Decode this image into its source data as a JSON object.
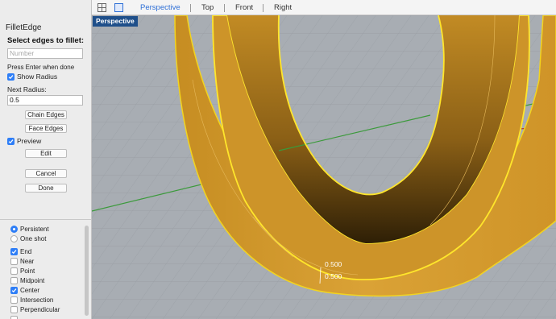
{
  "command": {
    "title": "FilletEdge",
    "prompt": "Select edges to fillet:",
    "number_placeholder": "Number",
    "hint": "Press Enter when done",
    "show_radius_label": "Show Radius",
    "show_radius_checked": true,
    "next_radius_label": "Next Radius:",
    "next_radius_value": "0.5",
    "chain_edges_label": "Chain Edges",
    "face_edges_label": "Face Edges",
    "preview_label": "Preview",
    "preview_checked": true,
    "edit_label": "Edit",
    "cancel_label": "Cancel",
    "done_label": "Done"
  },
  "osnap": {
    "modes": [
      {
        "label": "Persistent",
        "selected": true
      },
      {
        "label": "One shot",
        "selected": false
      }
    ],
    "items": [
      {
        "label": "End",
        "checked": true
      },
      {
        "label": "Near",
        "checked": false
      },
      {
        "label": "Point",
        "checked": false
      },
      {
        "label": "Midpoint",
        "checked": false
      },
      {
        "label": "Center",
        "checked": true
      },
      {
        "label": "Intersection",
        "checked": false
      },
      {
        "label": "Perpendicular",
        "checked": false
      }
    ]
  },
  "tabs": [
    {
      "label": "Perspective",
      "active": true
    },
    {
      "label": "Top",
      "active": false
    },
    {
      "label": "Front",
      "active": false
    },
    {
      "label": "Right",
      "active": false
    }
  ],
  "viewport": {
    "label": "Perspective",
    "radius_labels": [
      "0.500",
      "0.500"
    ]
  },
  "colors": {
    "accent": "#2e7ef7",
    "viewport_bg": "#a8adb3",
    "model_gold": "#d49b2a",
    "edge_highlight": "#ffe62b",
    "viewport_label_bg": "#1f4f8a"
  },
  "icons": [
    "grid-layout-icon",
    "single-viewport-icon",
    "checkmark-icon"
  ]
}
